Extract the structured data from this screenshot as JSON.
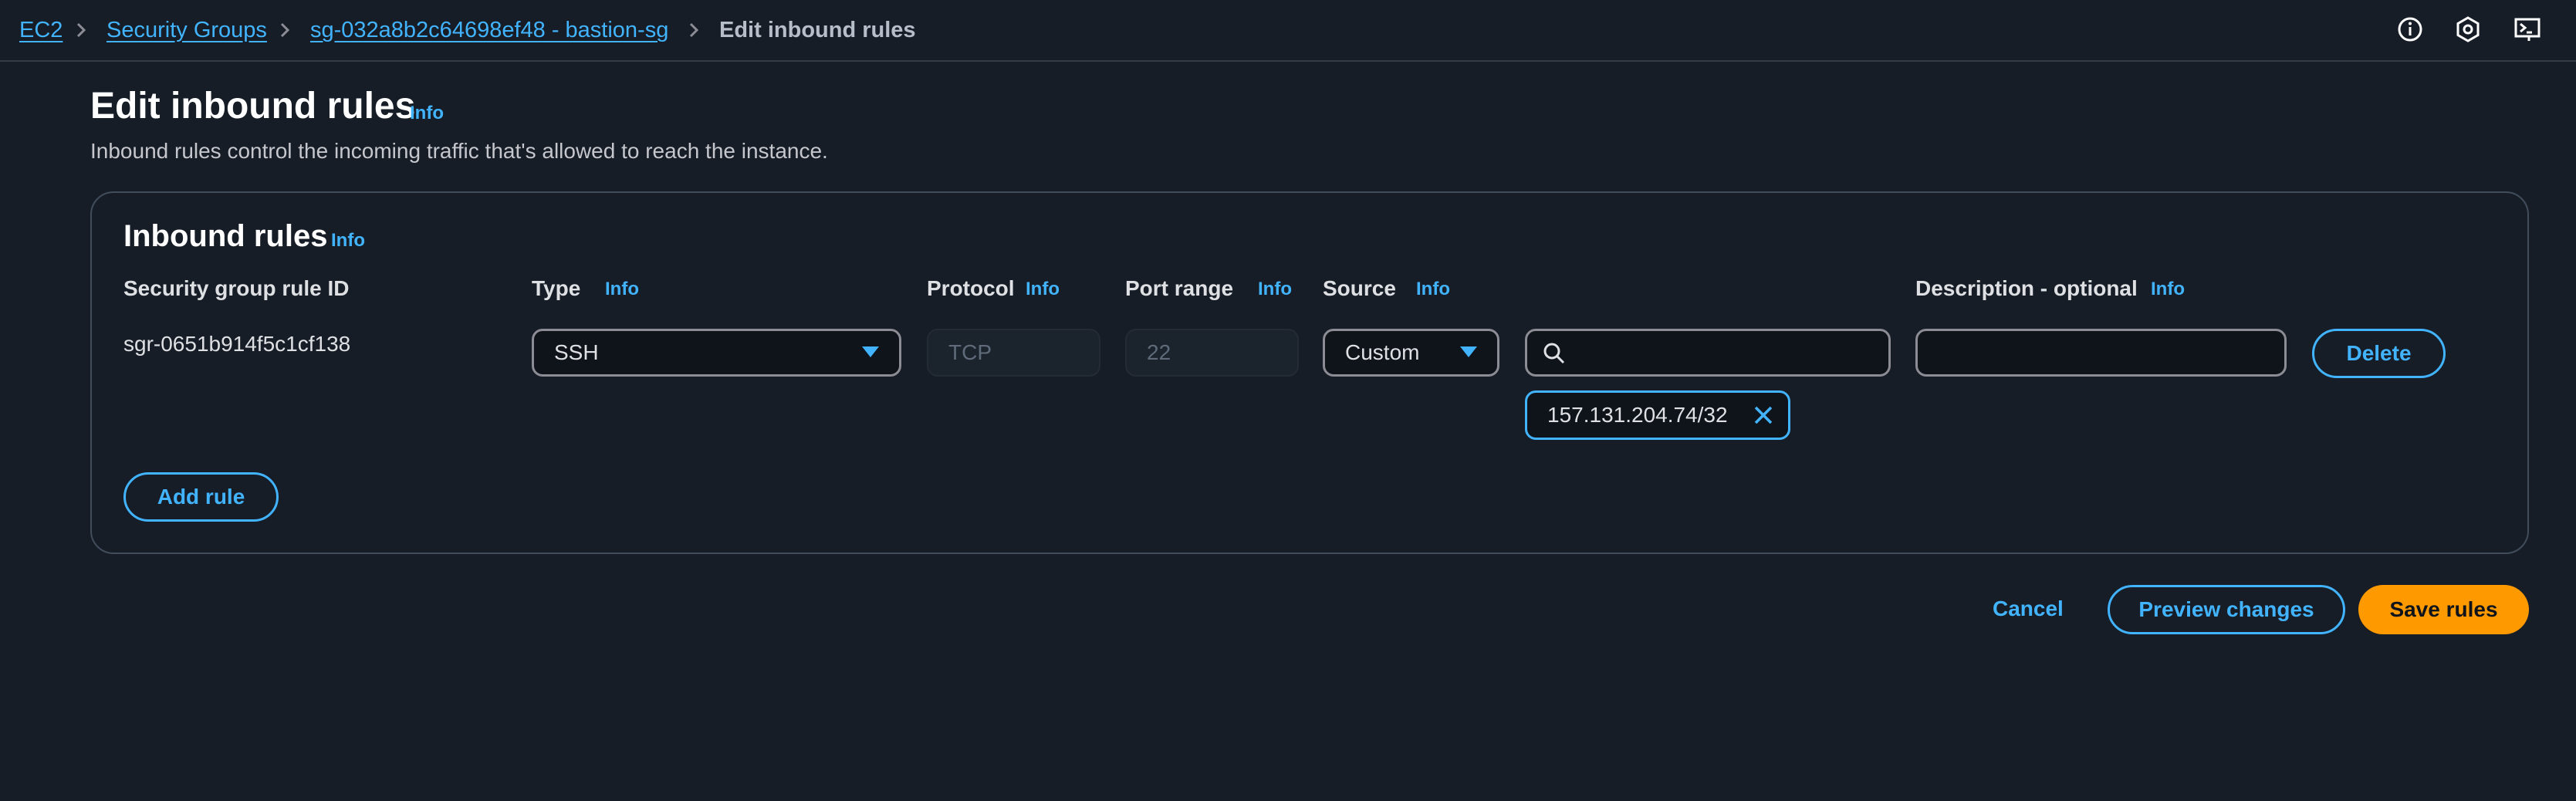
{
  "breadcrumb": {
    "items": [
      {
        "label": "EC2"
      },
      {
        "label": "Security Groups"
      },
      {
        "label": "sg-032a8b2c64698ef48 - bastion-sg"
      },
      {
        "label": "Edit inbound rules"
      }
    ]
  },
  "topbar_icons": [
    "info-circle-icon",
    "settings-hexagon-icon",
    "cloudshell-icon"
  ],
  "page": {
    "title": "Edit inbound rules",
    "info": "Info",
    "description": "Inbound rules control the incoming traffic that's allowed to reach the instance."
  },
  "inbound_rules": {
    "title": "Inbound rules",
    "info": "Info",
    "columns": {
      "rule_id": "Security group rule ID",
      "type": "Type",
      "protocol": "Protocol",
      "port_range": "Port range",
      "source": "Source",
      "description": "Description - optional",
      "info": "Info"
    },
    "rules": [
      {
        "rule_id": "sgr-0651b914f5c1cf138",
        "type": "SSH",
        "protocol": "TCP",
        "port_range": "22",
        "source_type": "Custom",
        "source_search_value": "",
        "source_token": "157.131.204.74/32",
        "description": "",
        "delete_label": "Delete"
      }
    ],
    "add_rule_label": "Add rule"
  },
  "footer": {
    "cancel_label": "Cancel",
    "preview_label": "Preview changes",
    "save_label": "Save rules"
  },
  "colors": {
    "background": "#161d26",
    "link": "#42b4ff",
    "primary_button": "#ff9900",
    "border": "#414d5c"
  }
}
